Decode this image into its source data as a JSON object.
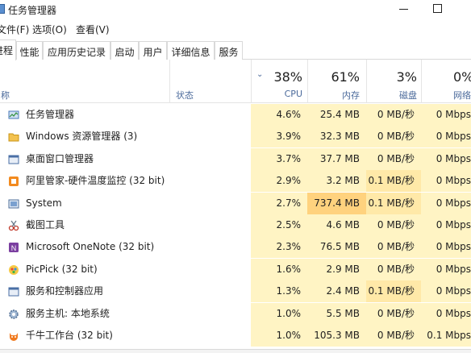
{
  "window": {
    "title": "任务管理器"
  },
  "menu": [
    "文件(F)",
    "选项(O)",
    "查看(V)"
  ],
  "tabs": [
    {
      "label": "进程",
      "active": true
    },
    {
      "label": "性能",
      "active": false
    },
    {
      "label": "应用历史记录",
      "active": false
    },
    {
      "label": "启动",
      "active": false
    },
    {
      "label": "用户",
      "active": false
    },
    {
      "label": "详细信息",
      "active": false
    },
    {
      "label": "服务",
      "active": false
    }
  ],
  "columns": {
    "name": "名称",
    "status": "状态",
    "cpu": {
      "pct": "38%",
      "label": "CPU"
    },
    "memory": {
      "pct": "61%",
      "label": "内存"
    },
    "disk": {
      "pct": "3%",
      "label": "磁盘"
    },
    "network": {
      "pct": "0%",
      "label": "网络"
    }
  },
  "processes": [
    {
      "name": "任务管理器",
      "icon": "task-manager-icon",
      "cpu": "4.6%",
      "memory": "25.4 MB",
      "disk": "0 MB/秒",
      "network": "0 Mbps",
      "disk_heat": 1,
      "mem_heat": 1
    },
    {
      "name": "Windows 资源管理器 (3)",
      "icon": "folder-icon",
      "cpu": "3.9%",
      "memory": "32.3 MB",
      "disk": "0 MB/秒",
      "network": "0 Mbps",
      "disk_heat": 1,
      "mem_heat": 1
    },
    {
      "name": "桌面窗口管理器",
      "icon": "window-icon",
      "cpu": "3.7%",
      "memory": "37.7 MB",
      "disk": "0 MB/秒",
      "network": "0 Mbps",
      "disk_heat": 1,
      "mem_heat": 1
    },
    {
      "name": "阿里管家-硬件温度监控 (32 bit)",
      "icon": "monitor-app-icon",
      "cpu": "2.9%",
      "memory": "3.2 MB",
      "disk": "0.1 MB/秒",
      "network": "0 Mbps",
      "disk_heat": 2,
      "mem_heat": 1
    },
    {
      "name": "System",
      "icon": "system-icon",
      "cpu": "2.7%",
      "memory": "737.4 MB",
      "disk": "0.1 MB/秒",
      "network": "0 Mbps",
      "disk_heat": 2,
      "mem_heat": 3
    },
    {
      "name": "截图工具",
      "icon": "snipping-tool-icon",
      "cpu": "2.5%",
      "memory": "4.6 MB",
      "disk": "0 MB/秒",
      "network": "0 Mbps",
      "disk_heat": 1,
      "mem_heat": 1
    },
    {
      "name": "Microsoft OneNote (32 bit)",
      "icon": "onenote-icon",
      "cpu": "2.3%",
      "memory": "76.5 MB",
      "disk": "0 MB/秒",
      "network": "0 Mbps",
      "disk_heat": 1,
      "mem_heat": 1
    },
    {
      "name": "PicPick (32 bit)",
      "icon": "picpick-icon",
      "cpu": "1.6%",
      "memory": "2.9 MB",
      "disk": "0 MB/秒",
      "network": "0 Mbps",
      "disk_heat": 1,
      "mem_heat": 1
    },
    {
      "name": "服务和控制器应用",
      "icon": "window-icon",
      "cpu": "1.3%",
      "memory": "2.4 MB",
      "disk": "0.1 MB/秒",
      "network": "0 Mbps",
      "disk_heat": 2,
      "mem_heat": 1
    },
    {
      "name": "服务主机: 本地系统",
      "icon": "gear-icon",
      "cpu": "1.0%",
      "memory": "5.5 MB",
      "disk": "0 MB/秒",
      "network": "0 Mbps",
      "disk_heat": 1,
      "mem_heat": 1
    },
    {
      "name": "千牛工作台 (32 bit)",
      "icon": "qianniu-icon",
      "cpu": "1.0%",
      "memory": "105.3 MB",
      "disk": "0 MB/秒",
      "network": "0.1 Mbps",
      "disk_heat": 1,
      "mem_heat": 1
    }
  ],
  "colors": {
    "heat_low": "#fff4c4",
    "heat_mid": "#ffe9a8",
    "heat_high": "#ffd27e",
    "header_label": "#4b6a9b"
  }
}
